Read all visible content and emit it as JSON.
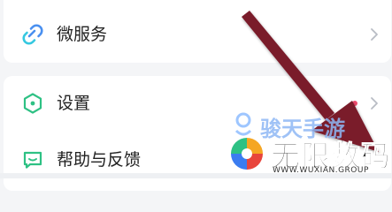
{
  "menu": {
    "items": [
      {
        "label": "微服务",
        "icon": "link-icon"
      },
      {
        "label": "设置",
        "icon": "hexagon-settings-icon",
        "badge_color": "#f04b6e"
      },
      {
        "label": "帮助与反馈",
        "icon": "feedback-icon"
      }
    ]
  },
  "watermarks": {
    "top_text": "骏天手游",
    "main_text": "无限数码",
    "sub_text": "WWW.WUXIAN.GROUP"
  },
  "colors": {
    "accent_green": "#2ec184",
    "icon_blue": "#4a90f0",
    "arrow": "#7a1a2a",
    "badge": "#f04b6e"
  }
}
